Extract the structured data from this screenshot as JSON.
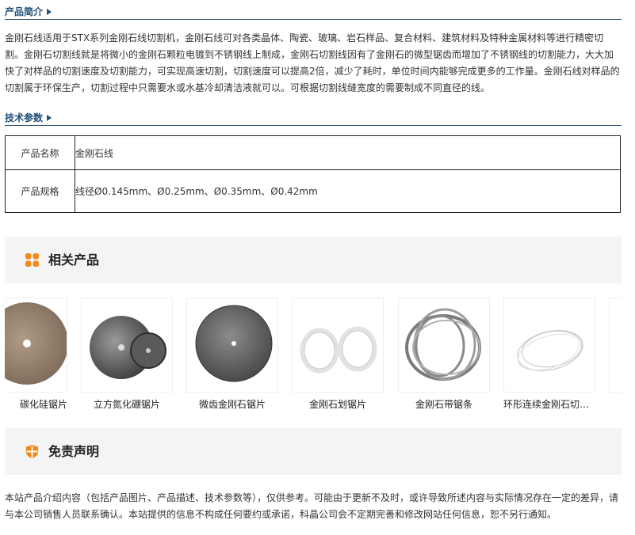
{
  "intro_section": {
    "title": "产品简介",
    "text": "金刚石线适用于STX系列金刚石线切割机，金刚石线可对各类晶体、陶瓷、玻璃、岩石样品、复合材料、建筑材料及特种金属材料等进行精密切割。金刚石切割线就是将微小的金刚石颗粒电镀到不锈钢线上制成，金刚石切割线因有了金刚石的微型锯齿而增加了不锈钢线的切割能力，大大加快了对样品的切割速度及切割能力，可实现高速切割，切割速度可以提高2倍，减少了耗时，单位时间内能够完成更多的工作量。金刚石线对样品的切割属于环保生产，切割过程中只需要水或水基冷却清洁液就可以。可根据切割线缝宽度的需要制成不同直径的线。"
  },
  "params_section": {
    "title": "技术参数",
    "rows": [
      {
        "label": "产品名称",
        "value": "金刚石线"
      },
      {
        "label": "产品规格",
        "value": "线径Ø0.145mm、Ø0.25mm、Ø0.35mm、Ø0.42mm"
      }
    ]
  },
  "related_section": {
    "title": "相关产品",
    "icon": "flower-icon",
    "accent": "#f08a1c",
    "products": [
      {
        "caption": "碳化硅锯片",
        "icon": "diamond-blade-icon"
      },
      {
        "caption": "立方氮化硼锯片",
        "icon": "cbn-blade-icon"
      },
      {
        "caption": "微齿金刚石锯片",
        "icon": "microtooth-blade-icon"
      },
      {
        "caption": "金刚石划锯片",
        "icon": "scribe-ring-icon"
      },
      {
        "caption": "金刚石带锯条",
        "icon": "band-saw-icon"
      },
      {
        "caption": "环形连续金刚石切割线",
        "icon": "wire-loop-icon"
      }
    ]
  },
  "disclaimer_section": {
    "title": "免责声明",
    "icon": "shield-icon",
    "text": "本站产品介绍内容（包括产品图片、产品描述、技术参数等），仅供参考。可能由于更新不及时，或许导致所述内容与实际情况存在一定的差异，请与本公司销售人员联系确认。本站提供的信息不构成任何要约或承诺，科晶公司会不定期完善和修改网站任何信息，恕不另行通知。"
  }
}
